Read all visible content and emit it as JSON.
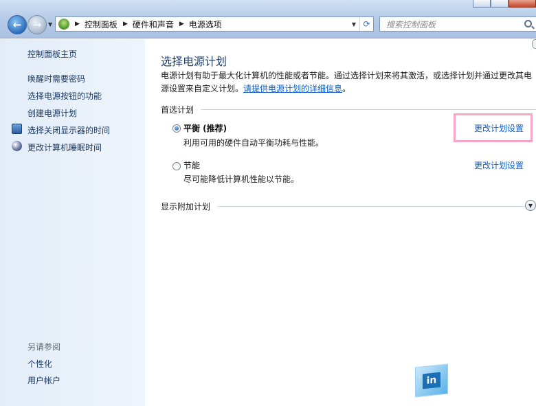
{
  "address_bar": {
    "crumbs": [
      "控制面板",
      "硬件和声音",
      "电源选项"
    ]
  },
  "search": {
    "placeholder": "搜索控制面板"
  },
  "sidebar": {
    "home": "控制面板主页",
    "links": [
      {
        "label": "唤醒时需要密码",
        "icon": null
      },
      {
        "label": "选择电源按钮的功能",
        "icon": null
      },
      {
        "label": "创建电源计划",
        "icon": null
      },
      {
        "label": "选择关闭显示器的时间",
        "icon": "shield-monitor-icon"
      },
      {
        "label": "更改计算机睡眠时间",
        "icon": "moon-icon"
      }
    ],
    "see_also_heading": "另请参阅",
    "see_also": [
      "个性化",
      "用户帐户"
    ]
  },
  "main": {
    "title": "选择电源计划",
    "description": "电源计划有助于最大化计算机的性能或者节能。通过选择计划来将其激活，或选择计划并通过更改其电源设置来自定义计划。",
    "description_link": "请提供电源计划的详细信息",
    "description_end": "。",
    "preferred_heading": "首选计划",
    "plans": [
      {
        "name": "平衡 (推荐)",
        "description": "利用可用的硬件自动平衡功耗与性能。",
        "selected": true,
        "link": "更改计划设置"
      },
      {
        "name": "节能",
        "description": "尽可能降低计算机性能以节能。",
        "selected": false,
        "link": "更改计划设置"
      }
    ],
    "additional_heading": "显示附加计划"
  },
  "watermark": {
    "text": "in"
  },
  "colors": {
    "link": "#0b5ec7",
    "highlight": "#f6a6c8",
    "sidebar_bg": "#e3edf8"
  }
}
